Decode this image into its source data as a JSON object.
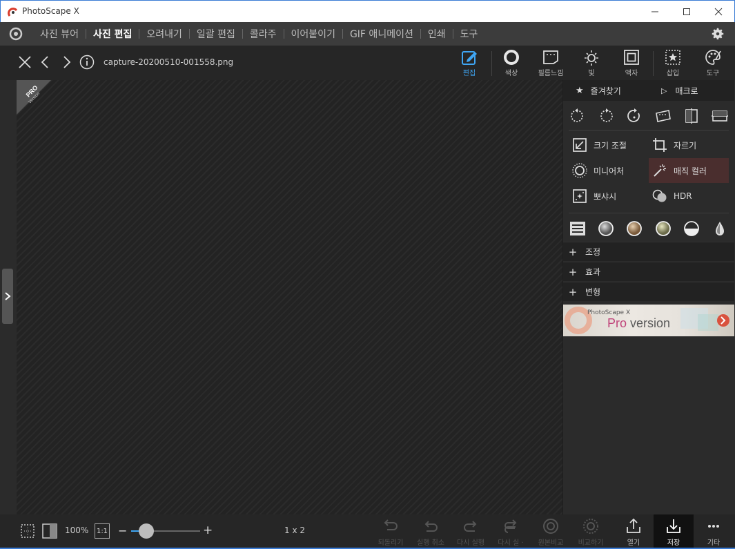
{
  "window": {
    "title": "PhotoScape X",
    "controls": {
      "minimize": "minimize",
      "maximize": "maximize",
      "close": "close"
    }
  },
  "menu": {
    "items": [
      "사진 뷰어",
      "사진 편집",
      "오려내기",
      "일괄 편집",
      "콜라주",
      "이어붙이기",
      "GIF 애니메이션",
      "인쇄",
      "도구"
    ],
    "active": "사진 편집"
  },
  "toolbar": {
    "filename": "capture-20200510-001558.png",
    "tools": [
      {
        "label": "편집",
        "icon": "edit-pencil-icon",
        "active": true
      },
      {
        "label": "색상",
        "icon": "color-ring-icon"
      },
      {
        "label": "필름느낌",
        "icon": "film-icon"
      },
      {
        "label": "빛",
        "icon": "light-sun-icon"
      },
      {
        "label": "액자",
        "icon": "frame-icon"
      },
      {
        "label": "삽입",
        "icon": "insert-star-icon"
      },
      {
        "label": "도구",
        "icon": "palette-icon"
      }
    ]
  },
  "canvas": {
    "ribbon_big": "PRO",
    "ribbon_small": "Version"
  },
  "panel": {
    "favorites_label": "즐겨찾기",
    "macro_label": "매크로",
    "features": [
      {
        "label": "크기 조절",
        "icon": "resize-icon"
      },
      {
        "label": "자르기",
        "icon": "crop-icon"
      },
      {
        "label": "미니어처",
        "icon": "miniature-icon"
      },
      {
        "label": "매직 컬러",
        "icon": "magic-wand-icon",
        "highlighted": true
      },
      {
        "label": "뽀샤시",
        "icon": "bloom-icon"
      },
      {
        "label": "HDR",
        "icon": "hdr-icon"
      }
    ],
    "sections": [
      "조정",
      "효과",
      "변형"
    ],
    "banner": {
      "small": "PhotoScape X",
      "pro": "Pro",
      "version": " version"
    }
  },
  "status": {
    "zoom": "100%",
    "one_to_one": "1:1",
    "zoom_minus": "−",
    "zoom_plus": "+",
    "zoom_level": 0.22,
    "page_info": "1 x 2",
    "actions": [
      {
        "label": "되돌리기",
        "enabled": false
      },
      {
        "label": "실행 취소",
        "enabled": false
      },
      {
        "label": "다시 실행",
        "enabled": false
      },
      {
        "label": "다시 실 ·",
        "enabled": false
      },
      {
        "label": "원본비교",
        "enabled": false
      },
      {
        "label": "비교하기",
        "enabled": false
      },
      {
        "label": "열기",
        "enabled": true
      },
      {
        "label": "저장",
        "enabled": true
      },
      {
        "label": "기타",
        "enabled": true
      }
    ]
  },
  "colors": {
    "accent": "#3fa6f4",
    "background": "#2b2b2b",
    "highlight": "#4a2e2e"
  }
}
